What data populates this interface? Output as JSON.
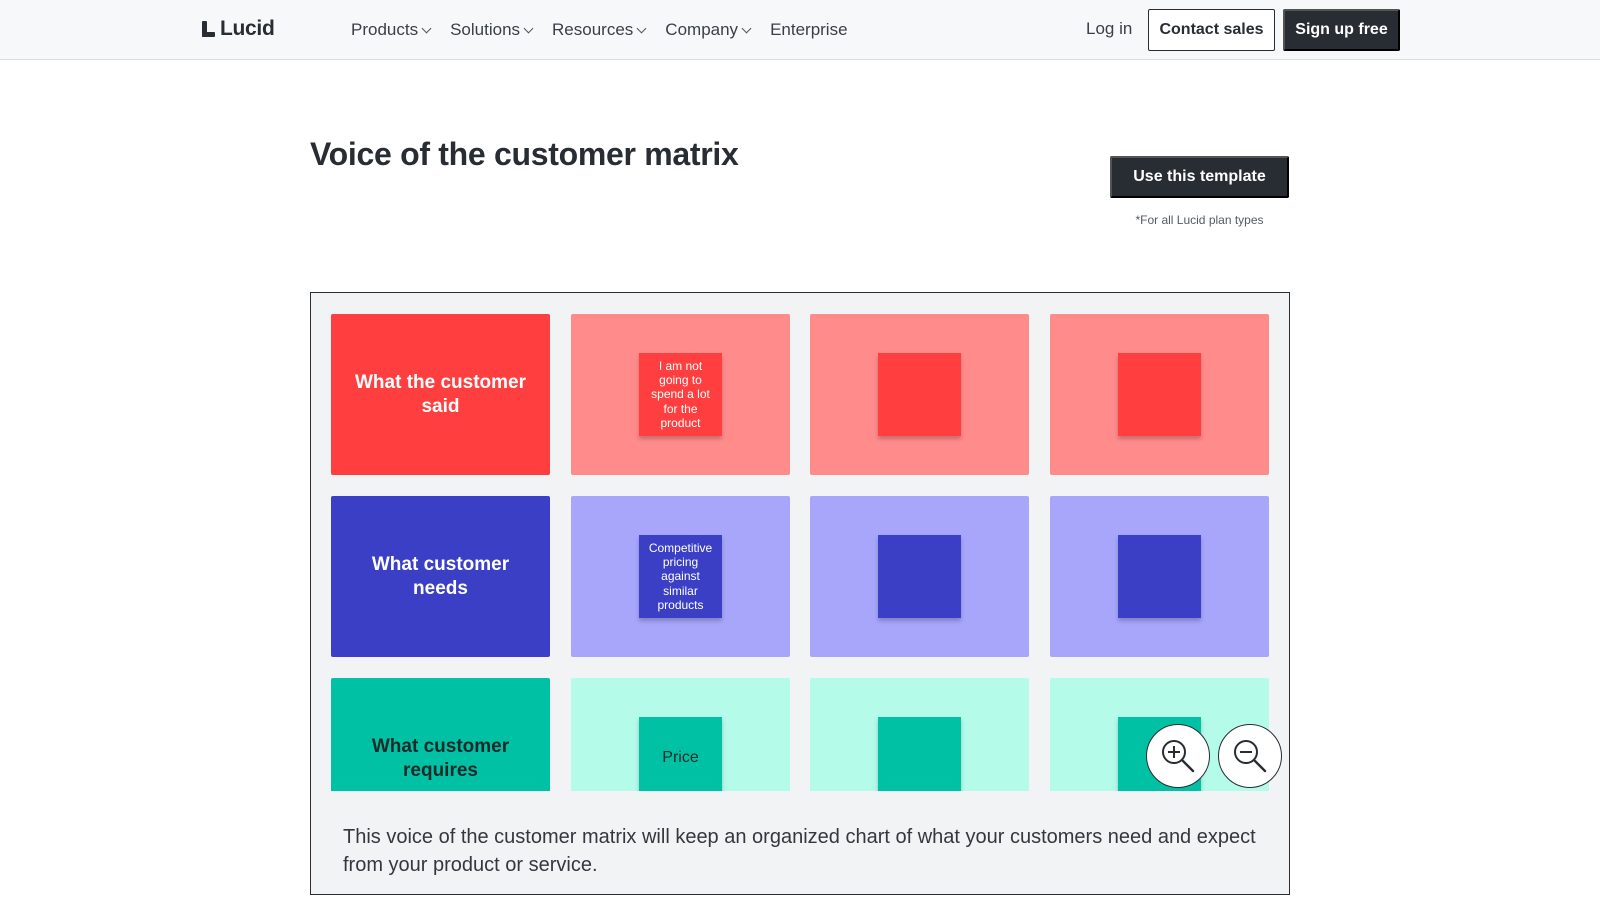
{
  "header": {
    "logo_text": "Lucid",
    "nav": [
      {
        "label": "Products",
        "dropdown": true
      },
      {
        "label": "Solutions",
        "dropdown": true
      },
      {
        "label": "Resources",
        "dropdown": true
      },
      {
        "label": "Company",
        "dropdown": true
      },
      {
        "label": "Enterprise",
        "dropdown": false
      }
    ],
    "login_label": "Log in",
    "contact_label": "Contact sales",
    "signup_label": "Sign up free"
  },
  "page": {
    "title": "Voice of the customer matrix",
    "cta_label": "Use this template",
    "cta_note": "*For all Lucid plan types"
  },
  "matrix": {
    "rows": [
      {
        "header": "What the customer said",
        "header_color": "#ff3f3f",
        "cell_color": "#ff8b8b",
        "note_color": "#ff3f3f",
        "header_text_color": "#ffffff",
        "note_text_color": "#ffffff",
        "notes": [
          "I am not going to spend a lot for the product",
          "",
          ""
        ]
      },
      {
        "header": "What customer needs",
        "header_color": "#3a3fc6",
        "cell_color": "#a7a6fb",
        "note_color": "#3a3fc6",
        "header_text_color": "#ffffff",
        "note_text_color": "#ffffff",
        "notes": [
          "Competitive pricing against similar products",
          "",
          ""
        ]
      },
      {
        "header": "What customer requires",
        "header_color": "#00c1a3",
        "cell_color": "#b4fbea",
        "note_color": "#00c1a3",
        "header_text_color": "#1c2a2a",
        "note_text_color": "#1c2a2a",
        "notes": [
          "Price",
          "",
          ""
        ]
      }
    ]
  },
  "zoom": {
    "in_icon": "zoom-in-icon",
    "out_icon": "zoom-out-icon"
  },
  "description": "This voice of the customer matrix will keep an organized chart of what your customers need and expect from your product or service."
}
